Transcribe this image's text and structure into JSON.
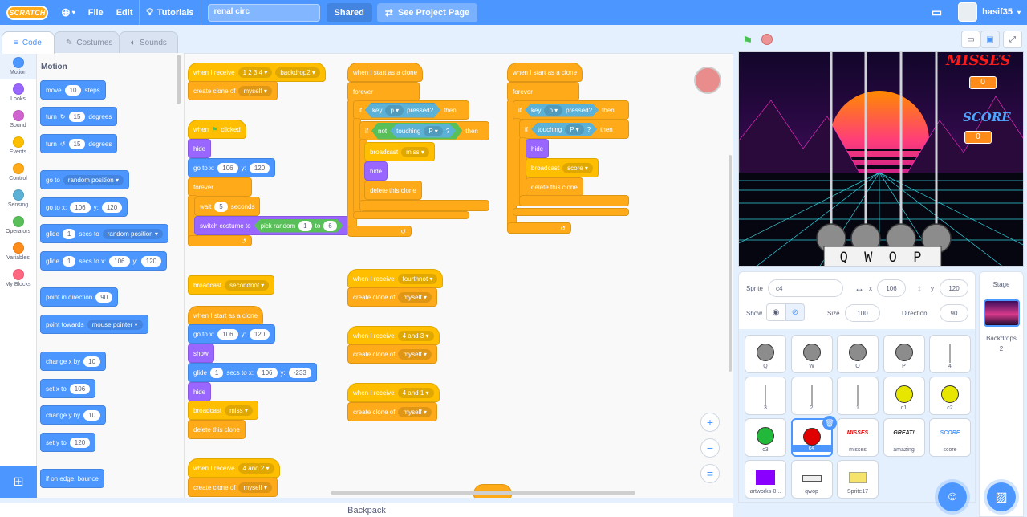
{
  "menubar": {
    "logo": "SCRATCH",
    "file": "File",
    "edit": "Edit",
    "tutorials": "Tutorials",
    "project_title": "renal circ",
    "shared": "Shared",
    "see_project_page": "See Project Page",
    "username": "hasif35"
  },
  "tabs": {
    "code": "Code",
    "costumes": "Costumes",
    "sounds": "Sounds"
  },
  "categories": [
    {
      "label": "Motion",
      "color": "#4c97ff"
    },
    {
      "label": "Looks",
      "color": "#9966ff"
    },
    {
      "label": "Sound",
      "color": "#cf63cf"
    },
    {
      "label": "Events",
      "color": "#ffbf00"
    },
    {
      "label": "Control",
      "color": "#ffab19"
    },
    {
      "label": "Sensing",
      "color": "#5cb1d6"
    },
    {
      "label": "Operators",
      "color": "#59c059"
    },
    {
      "label": "Variables",
      "color": "#ff8c1a"
    },
    {
      "label": "My Blocks",
      "color": "#ff6680"
    }
  ],
  "palette": {
    "heading": "Motion",
    "move": "move",
    "move_steps": "10",
    "steps": "steps",
    "turn": "turn",
    "turn_r": "15",
    "turn_l": "15",
    "degrees": "degrees",
    "goto": "go to",
    "random_position": "random position",
    "goto_x_label": "go to x:",
    "goto_x": "106",
    "y_label": "y:",
    "goto_y": "120",
    "glide": "glide",
    "glide_secs": "1",
    "secs_to": "secs to",
    "secs_to_x": "secs to x:",
    "glide_x": "106",
    "glide_y": "120",
    "point_in_direction": "point in direction",
    "direction": "90",
    "point_towards": "point towards",
    "mouse_pointer": "mouse pointer",
    "change_x": "change x by",
    "change_x_val": "10",
    "set_x": "set x to",
    "set_x_val": "106",
    "change_y": "change y by",
    "change_y_val": "10",
    "set_y": "set y to",
    "set_y_val": "120",
    "bounce": "if on edge, bounce"
  },
  "scripts": {
    "when_i_receive": "when I receive",
    "when_start_clone": "when I start as a clone",
    "create_clone_of": "create clone of",
    "myself": "myself",
    "forever": "forever",
    "if": "if",
    "then": "then",
    "key": "key",
    "pressed": "pressed?",
    "not": "not",
    "touching": "touching",
    "question": "?",
    "broadcast": "broadcast",
    "hide": "hide",
    "show": "show",
    "delete_clone": "delete this clone",
    "when_flag": "when",
    "clicked": "clicked",
    "goto_x_label": "go to x:",
    "y_label": "y:",
    "wait": "wait",
    "seconds": "seconds",
    "switch_costume": "switch costume to",
    "pick_random": "pick random",
    "to": "to",
    "glide": "glide",
    "secs_to_x": "secs to x:",
    "msg_1234": "1 2 3 4",
    "backdrop2": "backdrop2",
    "x106": "106",
    "y120": "120",
    "wait_val": "5",
    "rand_from": "1",
    "rand_to": "6",
    "secondnot": "secondnot",
    "glide_secs": "1",
    "glide_y": "-233",
    "miss": "miss",
    "score": "score",
    "msg_42": "4 and 2",
    "key_p": "p",
    "touching_p": "P",
    "fourthnot": "fourthnot",
    "msg_43": "4 and 3",
    "msg_41": "4 and 1"
  },
  "backpack": "Backpack",
  "stage": {
    "misses_label": "MISSES",
    "misses_val": "0",
    "score_label": "SCORE",
    "score_val": "0",
    "keys": "Q W O P"
  },
  "sprite_panel": {
    "sprite_label": "Sprite",
    "sprite_name": "c4",
    "x_label": "x",
    "x": "106",
    "y_label": "y",
    "y": "120",
    "show_label": "Show",
    "size_label": "Size",
    "size": "100",
    "direction_label": "Direction",
    "direction": "90"
  },
  "sprites": [
    {
      "name": "Q",
      "kind": "gray"
    },
    {
      "name": "W",
      "kind": "gray"
    },
    {
      "name": "O",
      "kind": "gray"
    },
    {
      "name": "P",
      "kind": "gray"
    },
    {
      "name": "4",
      "kind": "stick"
    },
    {
      "name": "3",
      "kind": "stick"
    },
    {
      "name": "2",
      "kind": "stick"
    },
    {
      "name": "1",
      "kind": "stick"
    },
    {
      "name": "c1",
      "kind": "yellow"
    },
    {
      "name": "c2",
      "kind": "yellow"
    },
    {
      "name": "c3",
      "kind": "green"
    },
    {
      "name": "c4",
      "kind": "red"
    },
    {
      "name": "misses",
      "kind": "misses"
    },
    {
      "name": "amazing",
      "kind": "great"
    },
    {
      "name": "score",
      "kind": "scoretxt"
    },
    {
      "name": "artworks-0...",
      "kind": "purple"
    },
    {
      "name": "qwop",
      "kind": "qwop"
    },
    {
      "name": "Sprite17",
      "kind": "sprite17"
    }
  ],
  "sprite_thumb_text": {
    "misses": "MISSES",
    "great": "GREAT!",
    "score": "SCORE"
  },
  "stage_panel": {
    "label": "Stage",
    "backdrops_label": "Backdrops",
    "backdrops_count": "2"
  }
}
